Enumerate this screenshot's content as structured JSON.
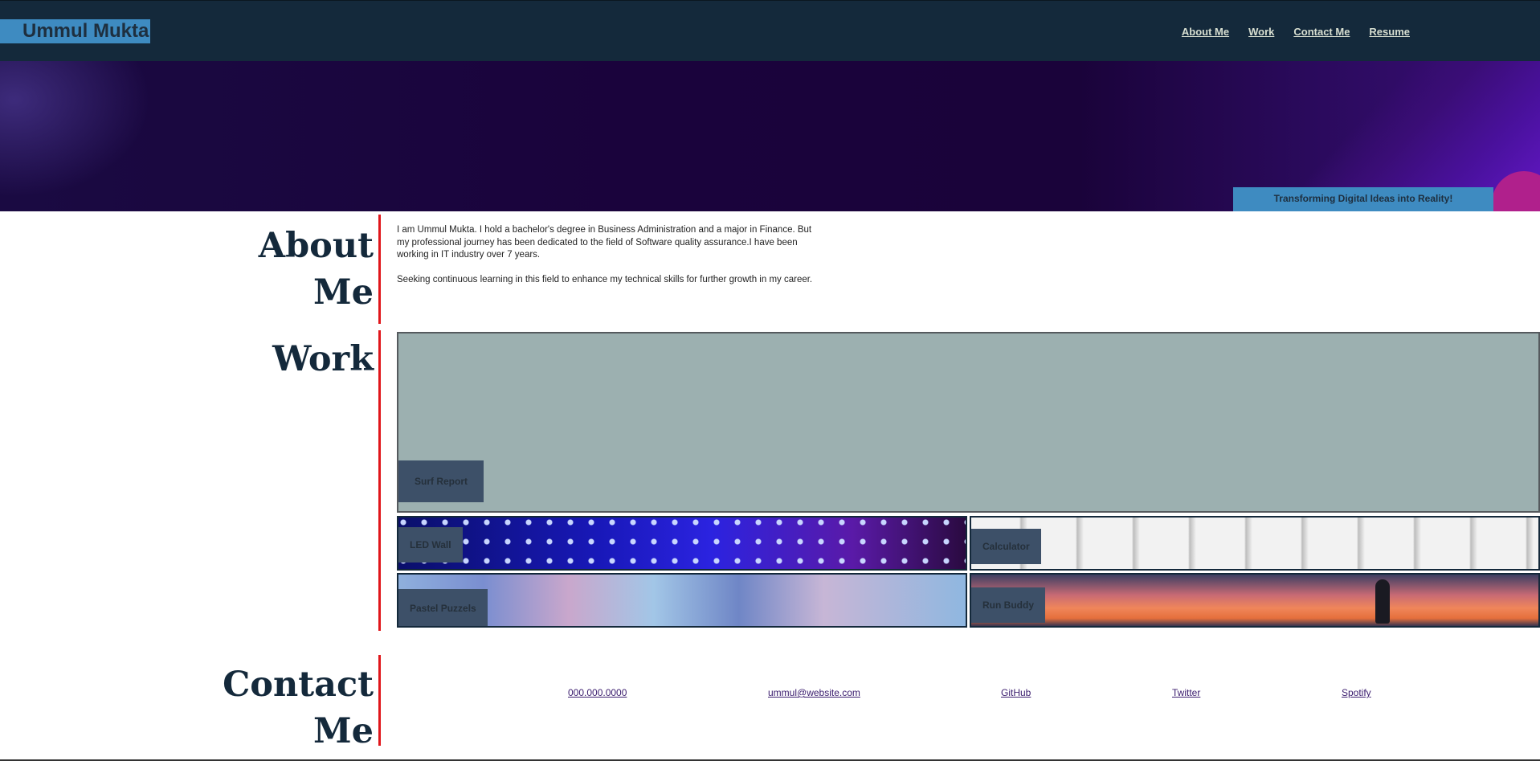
{
  "header": {
    "brand": "Ummul Mukta",
    "nav": [
      "About Me",
      "Work",
      "Contact Me",
      "Resume"
    ]
  },
  "hero": {
    "tagline": "Transforming Digital Ideas into Reality!"
  },
  "about": {
    "title_line1": "About",
    "title_line2": "Me",
    "paragraph1": "I am Ummul Mukta. I hold a bachelor's degree in Business Administration and a major in Finance. But my professional journey has been dedicated to the field of Software quality assurance.I have been working in IT industry over 7 years.",
    "paragraph2": "Seeking continuous learning in this field to enhance my technical skills for further growth in my career."
  },
  "work": {
    "title": "Work",
    "featured": "Surf Report",
    "projects": [
      "LED Wall",
      "Calculator",
      "Pastel Puzzels",
      "Run Buddy"
    ]
  },
  "contact": {
    "title_line1": "Contact",
    "title_line2": "Me",
    "links": [
      "000.000.0000",
      "ummul@website.com",
      "GitHub",
      "Twitter",
      "Spotify"
    ]
  },
  "colors": {
    "header_bg": "#14293b",
    "accent_blue": "#3e8bc1",
    "divider_red": "#e0161b",
    "label_bg": "#3d5068"
  }
}
